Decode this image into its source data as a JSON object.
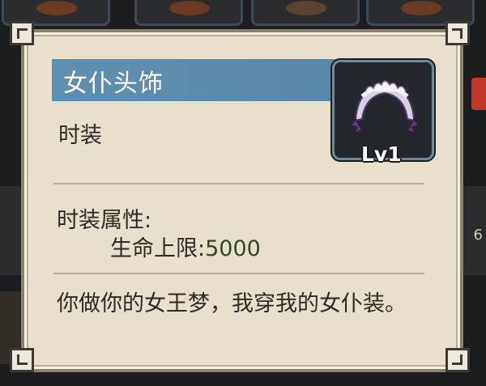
{
  "item": {
    "name": "女仆头饰",
    "category": "时装",
    "level": "Lv1",
    "icon": "maid-headdress-icon"
  },
  "attributes": {
    "header": "时装属性:",
    "stat_name": "生命上限:",
    "stat_value": "5000"
  },
  "description": "你做你的女王梦，我穿我的女仆装。",
  "background": {
    "right_partial_text": "6"
  },
  "colors": {
    "title_bar": "#5f8fb0",
    "panel_bg": "#e9dfcd",
    "stat_value": "#2f4a1e"
  }
}
